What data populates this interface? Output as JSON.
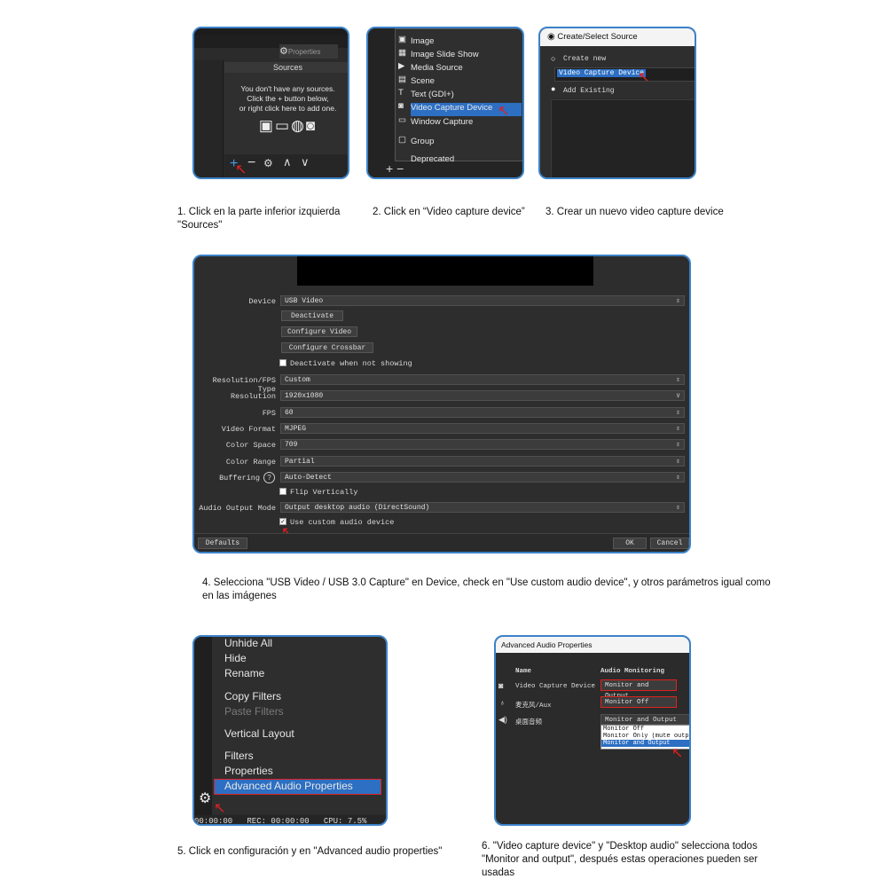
{
  "s1": {
    "properties_label": "Properties",
    "sources_title": "Sources",
    "empty_line1": "You don't have any sources.",
    "empty_line2": "Click the + button below,",
    "empty_line3": "or right click here to add one."
  },
  "s2": {
    "items": [
      "Image",
      "Image Slide Show",
      "Media Source",
      "Scene",
      "Text (GDI+)",
      "Video Capture Device",
      "Window Capture",
      "Group",
      "Deprecated"
    ]
  },
  "s3": {
    "title": "Create/Select Source",
    "create_new": "Create new",
    "name_value": "Video Capture Device",
    "add_existing": "Add Existing"
  },
  "s4": {
    "device_label": "Device",
    "device_value": "USB Video",
    "deactivate": "Deactivate",
    "configure_video": "Configure Video",
    "configure_crossbar": "Configure Crossbar",
    "deactivate_not_showing": "Deactivate when not showing",
    "res_type_label": "Resolution/FPS Type",
    "res_type_value": "Custom",
    "resolution_label": "Resolution",
    "resolution_value": "1920x1080",
    "fps_label": "FPS",
    "fps_value": "60",
    "video_format_label": "Video Format",
    "video_format_value": "MJPEG",
    "color_space_label": "Color Space",
    "color_space_value": "709",
    "color_range_label": "Color Range",
    "color_range_value": "Partial",
    "buffering_label": "Buffering",
    "buffering_value": "Auto-Detect",
    "flip": "Flip Vertically",
    "audio_mode_label": "Audio Output Mode",
    "audio_mode_value": "Output desktop audio (DirectSound)",
    "custom_audio": "Use custom audio device",
    "defaults": "Defaults",
    "ok": "OK",
    "cancel": "Cancel"
  },
  "s5": {
    "items": [
      "Unhide All",
      "Hide",
      "Rename",
      "Copy Filters",
      "Paste Filters",
      "Vertical Layout",
      "Filters",
      "Properties",
      "Advanced Audio Properties"
    ],
    "status": "00:00:00   REC: 00:00:00   CPU: 7.5%"
  },
  "s6": {
    "title": "Advanced Audio Properties",
    "col_name": "Name",
    "col_monitoring": "Audio Monitoring",
    "row1_name": "Video Capture Device",
    "row1_value": "Monitor and Output",
    "row2_name": "麦克风/Aux",
    "row2_value": "Monitor Off",
    "row3_name": "桌面音频",
    "row3_value": "Monitor and Output",
    "opt1": "Monitor Off",
    "opt2": "Monitor Only (mute outpu",
    "opt3": "Monitor and Output"
  },
  "captions": {
    "c1": "1. Click en la parte inferior izquierda \"Sources\"",
    "c2": "2. Click en “Video capture device”",
    "c3": "3. Crear un nuevo video capture device",
    "c4": "4. Selecciona \"USB Video / USB 3.0 Capture\" en Device, check en \"Use custom audio device\", y otros parámetros igual como en las imágenes",
    "c5": "5. Click en configuración y en \"Advanced audio properties\"",
    "c6": "6. \"Video capture device\" y \"Desktop audio\" selecciona todos \"Monitor and output\", después estas operaciones pueden ser usadas"
  }
}
